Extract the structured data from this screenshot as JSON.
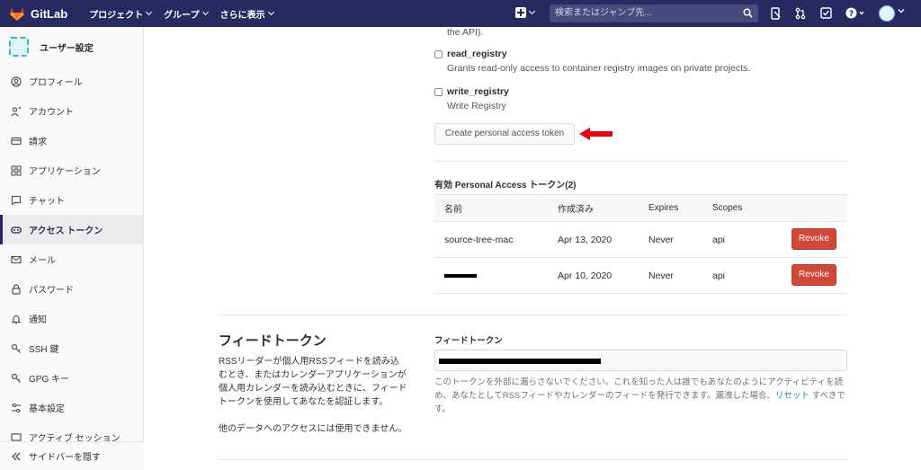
{
  "topbar": {
    "brand": "GitLab",
    "menu": [
      "プロジェクト",
      "グループ",
      "さらに表示"
    ],
    "search_placeholder": "検索またはジャンプ先...",
    "brand_color": "#292961"
  },
  "sidebar": {
    "title": "ユーザー設定",
    "items": [
      {
        "label": "プロフィール",
        "icon": "profile-icon"
      },
      {
        "label": "アカウント",
        "icon": "account-icon"
      },
      {
        "label": "請求",
        "icon": "billing-icon"
      },
      {
        "label": "アプリケーション",
        "icon": "applications-icon"
      },
      {
        "label": "チャット",
        "icon": "chat-icon"
      },
      {
        "label": "アクセス トークン",
        "icon": "token-icon",
        "active": true
      },
      {
        "label": "メール",
        "icon": "mail-icon"
      },
      {
        "label": "パスワード",
        "icon": "lock-icon"
      },
      {
        "label": "通知",
        "icon": "bell-icon"
      },
      {
        "label": "SSH 鍵",
        "icon": "key-icon"
      },
      {
        "label": "GPG キー",
        "icon": "key-icon"
      },
      {
        "label": "基本設定",
        "icon": "preferences-icon"
      },
      {
        "label": "アクティブ セッション",
        "icon": "sessions-icon"
      }
    ],
    "collapse_label": "サイドバーを隠す"
  },
  "scopes": {
    "top_fragment": "the API).",
    "items": [
      {
        "name": "read_registry",
        "desc": "Grants read-only access to container registry images on private projects."
      },
      {
        "name": "write_registry",
        "desc": "Write Registry"
      }
    ]
  },
  "create_button": "Create personal access token",
  "active_tokens": {
    "title": "有効 Personal Access トークン(2)",
    "headers": [
      "名前",
      "作成済み",
      "Expires",
      "Scopes"
    ],
    "rows": [
      {
        "name": "source-tree-mac",
        "created": "Apr 13, 2020",
        "expires": "Never",
        "scopes": "api",
        "action": "Revoke"
      },
      {
        "name": "",
        "created": "Apr 10, 2020",
        "expires": "Never",
        "scopes": "api",
        "action": "Revoke"
      }
    ],
    "revoke_color": "#d24838"
  },
  "feed": {
    "title": "フィードトークン",
    "desc": "RSSリーダーが個人用RSSフィードを読み込むとき、またはカレンダーアプリケーションが個人用カレンダーを読み込むときに、フィードトークンを使用してあなたを認証します。",
    "desc2": "他のデータへのアクセスには使用できません。",
    "label": "フィードトークン",
    "help_before": "このトークンを外部に漏らさないでください。これを知った人は誰でもあなたのようにアクティビティを読め、あなたとしてRSSフィードやカレンダーのフィードを発行できます。漏洩した場合、",
    "help_link": "リセット",
    "help_after": " すべきです。"
  }
}
